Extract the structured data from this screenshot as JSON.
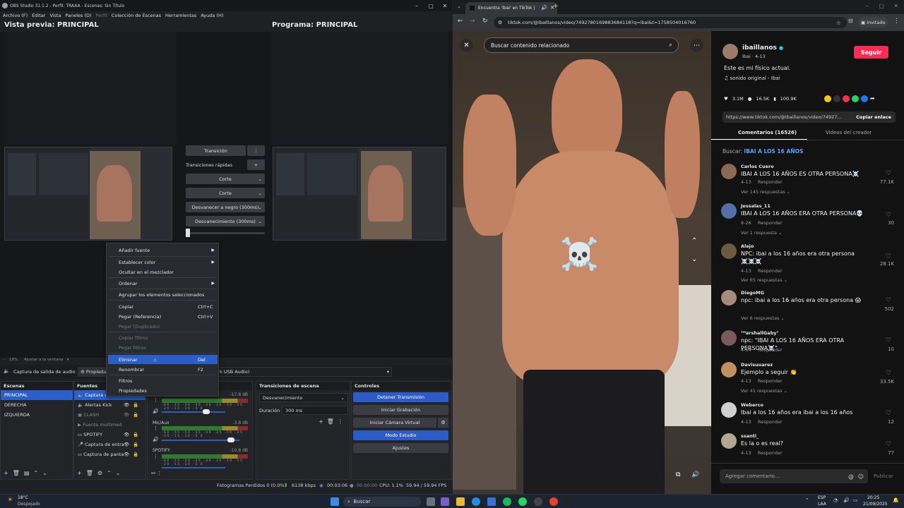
{
  "obs": {
    "title": "OBS Studio 31.1.2 - Perfil: TRAAA - Escenas: Sin Título",
    "menu": [
      "Archivo (F)",
      "Editar",
      "Vista",
      "Paneles (D)",
      "Perfil",
      "Colección de Escenas",
      "Herramientas",
      "Ayuda (H)"
    ],
    "preview_label": "Vista previa: PRINCIPAL",
    "program_label": "Programa: PRINCIPAL",
    "transition_button": "Transición",
    "quick_transitions": "Transiciones rápidas",
    "quick_items": [
      "Corte",
      "Corte",
      "Desvanecer a negro (300ms)",
      "Desvanecimiento (300ms)"
    ],
    "zoom": "18%",
    "fit_label": "Ajustar a la ventana",
    "source_toolbar_label": "Captura de salida de audio",
    "properties_label": "Propiedades",
    "audio_device_suffix": "k USB Audio)",
    "context_menu": [
      {
        "label": "Añadir fuente",
        "arrow": true
      },
      {
        "label": "Establecer color",
        "arrow": true
      },
      {
        "label": "Ocultar en el mezclador"
      },
      {
        "label": "Ordenar",
        "arrow": true
      },
      {
        "label": "Agrupar los elementos seleccionados"
      },
      {
        "label": "Copiar",
        "shortcut": "Ctrl+C"
      },
      {
        "label": "Pegar (Referencia)",
        "shortcut": "Ctrl+V"
      },
      {
        "label": "Pegar (Duplicado)",
        "disabled": true
      },
      {
        "label": "Copiar filtros",
        "disabled": true
      },
      {
        "label": "Pegar filtros",
        "disabled": true
      },
      {
        "label": "Eliminar",
        "shortcut": "Del",
        "selected": true
      },
      {
        "label": "Renombrar",
        "shortcut": "F2"
      },
      {
        "label": "Filtros"
      },
      {
        "label": "Propiedades"
      }
    ],
    "scenes_title": "Escenas",
    "scenes": [
      "PRINCIPAL",
      "DERECHA",
      "IZQUIERDA"
    ],
    "sources_title": "Fuentes",
    "sources": [
      "Captura de sal",
      "Alertas Kick",
      "CLASH",
      "Fuente multimed",
      "SPOTIFY",
      "Captura de entra",
      "Captura de panta"
    ],
    "mixer": [
      {
        "name": "",
        "db": "-17.8 dB"
      },
      {
        "name": "Mic/Aux",
        "db": "-3.8 dB"
      },
      {
        "name": "SPOTIFY",
        "db": "-10.8 dB"
      }
    ],
    "meter_ticks": "-60 -55 -50 -45 -40 -35 -30 -25 -20 -15 -10 -5 0",
    "transitions_title": "Transiciones de escena",
    "transition_select": "Desvanecimiento",
    "duration_label": "Duración",
    "duration_value": "300 ms",
    "controls_title": "Controles",
    "controls": [
      "Detener Transmisión",
      "Iniciar Grabación",
      "Iniciar Cámara Virtual",
      "Modo Estudio",
      "Ajustes"
    ],
    "status": {
      "dropped": "Fotogramas Perdidos 0 (0.0%)",
      "kbps": "6138 kbps",
      "stream_time": "00:03:06",
      "rec_time": "00:00:00",
      "cpu": "CPU: 1.1%",
      "fps": "59.94 / 59.94 FPS"
    }
  },
  "browser": {
    "tab_title": "Encuentra 'ibai' en TikTok |",
    "url": "tiktok.com/@ibaillanos/video/7492780169883684118?q=ibai&t=1758504016760",
    "profile_label": "Invitado",
    "search_placeholder": "Buscar contenido relacionado",
    "sticker": "☠️",
    "username": "ibaillanos",
    "subline": "Ibai · 4-13",
    "follow": "Seguir",
    "caption": "Este es mi físico actual.",
    "sound": "♫  sonido original - Ibai",
    "stats": {
      "likes": "3.1M",
      "comments": "16.5K",
      "saves": "100.9K"
    },
    "share_url": "https://www.tiktok.com/@ibaillanos/video/74927...",
    "copy_link": "Copiar enlace",
    "tabs": [
      "Comentarios (16526)",
      "Videos del creador"
    ],
    "search_prefix": "Buscar:",
    "search_term": "IBAI A LOS 16 AÑOS",
    "comments": [
      {
        "name": "Carlos Cuero",
        "text": "IBAI A LOS 16 AÑOS ES OTRA PERSONA☠️",
        "date": "4-13",
        "reply": "Responder",
        "likes": "77.1K",
        "more": "Ver 145 respuestas ⌄",
        "color": "#8a6a52"
      },
      {
        "name": "Jessalas_11",
        "text": "IBAI A LOS 16 AÑOS ERA OTRA PERSONA💀",
        "date": "8-26",
        "reply": "Responder",
        "likes": "30",
        "more": "Ver 1 respuesta ⌄",
        "color": "#5470a8"
      },
      {
        "name": "Alejo",
        "text": "NPC: ibai a los 16 años era otra persona ☠️☠️☠️",
        "date": "4-13",
        "reply": "Responder",
        "likes": "28.1K",
        "more": "Ver 65 respuestas ⌄",
        "color": "#6b5a44"
      },
      {
        "name": "DiegoMG",
        "text": "npc: ibai a los 16 años era otra persona 😱",
        "date": "",
        "reply": "",
        "likes": "502",
        "more": "Ver 6 respuestas ⌄",
        "color": "#a88a7a"
      },
      {
        "name": "⁷ᴹarshallGaby⁷",
        "text": "npc: \"IBAI A LOS 16 AÑOS ERA OTRA PERSONA☠️\"",
        "date": "4-14",
        "reply": "Responder",
        "likes": "10",
        "more": "",
        "color": "#7a5a5a"
      },
      {
        "name": "Davisuuarez",
        "text": "Ejemplo a seguir 👏",
        "date": "4-13",
        "reply": "Responder",
        "likes": "33.5K",
        "more": "Ver 41 respuestas ⌄",
        "color": "#c09060"
      },
      {
        "name": "Weberco",
        "text": "Ibai a los 16 años era ibai a los 16 años",
        "date": "4-13",
        "reply": "Responder",
        "likes": "12",
        "more": "",
        "color": "#d0d0d0"
      },
      {
        "name": "ssanti_",
        "text": "Es la o es real?",
        "date": "4-13",
        "reply": "Responder",
        "likes": "77",
        "more": "",
        "color": "#b0a890"
      }
    ],
    "add_comment": "Agregar comentario...",
    "publish": "Publicar"
  },
  "taskbar": {
    "weather_temp": "18°C",
    "weather_desc": "Despejado",
    "search": "Buscar",
    "lang": "ESP",
    "lang2": "LAA",
    "time": "20:25",
    "date": "21/09/2025"
  }
}
